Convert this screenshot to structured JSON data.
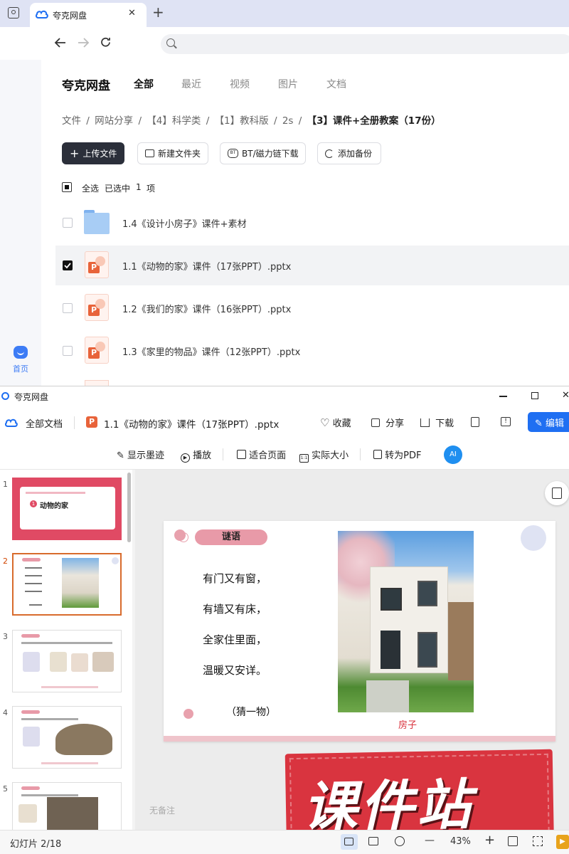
{
  "browser": {
    "tab_title": "夸克网盘",
    "new_tab_symbol": "+",
    "close_symbol": "✕"
  },
  "rail": {
    "home_label": "首页"
  },
  "drive": {
    "brand": "夸克网盘",
    "tabs": [
      {
        "label": "全部",
        "active": true
      },
      {
        "label": "最近",
        "active": false
      },
      {
        "label": "视频",
        "active": false
      },
      {
        "label": "图片",
        "active": false
      },
      {
        "label": "文档",
        "active": false
      }
    ],
    "breadcrumbs": [
      "文件",
      "网站分享",
      "【4】科学类",
      "【1】教科版",
      "2s",
      "【3】课件+全册教案（17份）"
    ],
    "breadcrumb_sep": "/",
    "toolbar": {
      "upload": "上传文件",
      "new_folder": "新建文件夹",
      "bt_download": "BT/磁力链下载",
      "add_backup": "添加备份"
    },
    "select_all": "全选",
    "selected_text": "已选中",
    "selected_count": "1",
    "selected_unit": "项",
    "files": [
      {
        "name": "1.4《设计小房子》课件+素材",
        "type": "folder",
        "checked": false
      },
      {
        "name": "1.1《动物的家》课件（17张PPT）.pptx",
        "type": "pptx",
        "checked": true
      },
      {
        "name": "1.2《我们的家》课件（16张PPT）.pptx",
        "type": "pptx",
        "checked": false
      },
      {
        "name": "1.3《家里的物品》课件（12张PPT）.pptx",
        "type": "pptx",
        "checked": false
      }
    ]
  },
  "viewer": {
    "window_title": "夸克网盘",
    "all_docs": "全部文档",
    "file_name": "1.1《动物的家》课件（17张PPT）.pptx",
    "actions": {
      "favorite": "收藏",
      "share": "分享",
      "download": "下载",
      "edit": "编辑"
    },
    "tools": {
      "show_ink": "显示墨迹",
      "play": "播放",
      "fit_page": "适合页面",
      "actual_size": "实际大小",
      "to_pdf": "转为PDF"
    },
    "thumb_numbers": [
      "1",
      "2",
      "3",
      "4",
      "5"
    ],
    "selected_thumb": "2",
    "thumb1_title": "动物的家",
    "thumb1_num": "1",
    "slide": {
      "tag": "谜语",
      "lines": [
        "有门又有窗，",
        "有墙又有床，",
        "全家住里面，",
        "温暖又安详。"
      ],
      "hint": "（猜一物）",
      "answer": "房子"
    },
    "watermark": "课件站",
    "notes": "无备注",
    "status_slide": "幻灯片 2/18",
    "zoom": "43%",
    "zoom_minus": "—",
    "zoom_plus": "+",
    "colors": {
      "accent": "#1f6ff2",
      "slide_pink": "#e05a70",
      "watermark_red": "#d9343f",
      "upload_bg": "#2b2f3a"
    }
  }
}
